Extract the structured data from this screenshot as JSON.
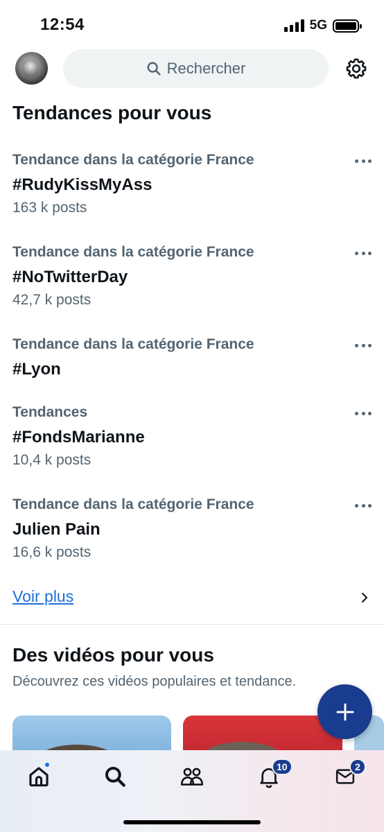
{
  "status_bar": {
    "time": "12:54",
    "network": "5G"
  },
  "header": {
    "search_placeholder": "Rechercher"
  },
  "trends_section": {
    "title": "Tendances pour vous",
    "items": [
      {
        "category": "Tendance dans la catégorie France",
        "name": "#RudyKissMyAss",
        "posts": "163 k posts"
      },
      {
        "category": "Tendance dans la catégorie France",
        "name": "#NoTwitterDay",
        "posts": "42,7 k posts"
      },
      {
        "category": "Tendance dans la catégorie France",
        "name": "#Lyon",
        "posts": ""
      },
      {
        "category": "Tendances",
        "name": "#FondsMarianne",
        "posts": "10,4 k posts"
      },
      {
        "category": "Tendance dans la catégorie France",
        "name": "Julien Pain",
        "posts": "16,6 k posts"
      }
    ],
    "see_more": "Voir plus"
  },
  "videos_section": {
    "title": "Des vidéos pour vous",
    "subtitle": "Découvrez ces vidéos populaires et tendance."
  },
  "tabbar": {
    "tabs": [
      {
        "name": "home",
        "icon": "home-icon",
        "has_dot": true
      },
      {
        "name": "search",
        "icon": "search-icon"
      },
      {
        "name": "communities",
        "icon": "people-icon"
      },
      {
        "name": "notifications",
        "icon": "bell-icon",
        "badge": "10"
      },
      {
        "name": "messages",
        "icon": "mail-icon",
        "badge": "2"
      }
    ]
  },
  "colors": {
    "accent": "#1a3c8f",
    "link": "#1d70d8",
    "secondary_text": "#536471",
    "search_bg": "#eff3f4"
  }
}
